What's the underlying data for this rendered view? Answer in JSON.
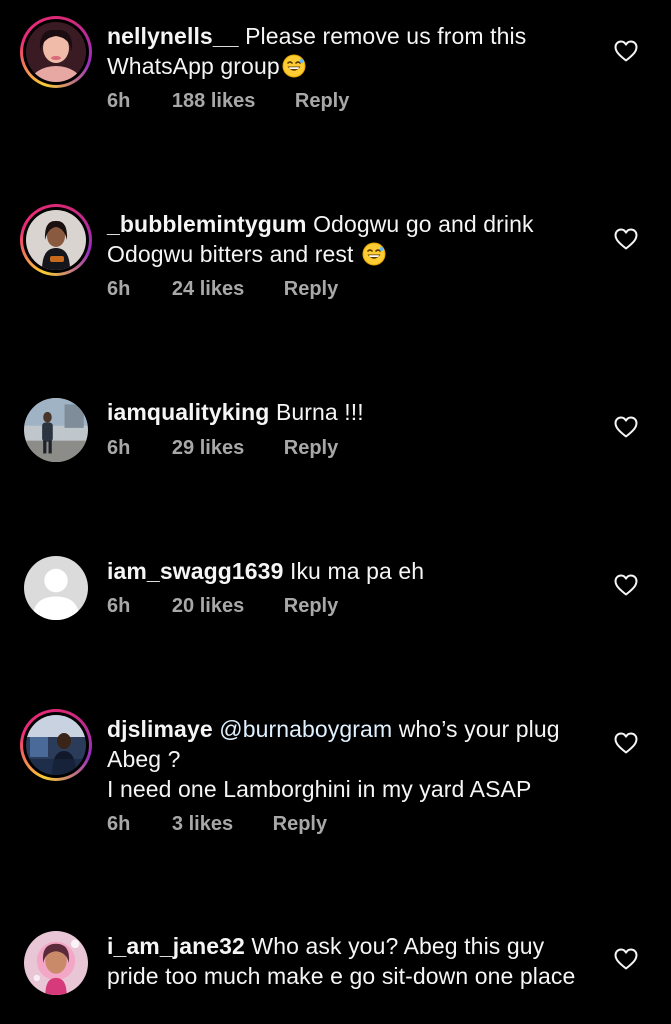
{
  "comments": [
    {
      "username": "nellynells__",
      "text": "Please remove us from this WhatsApp group",
      "emoji": "grinning-sweat-emoji",
      "time": "6h",
      "likes": "188 likes",
      "reply": "Reply"
    },
    {
      "username": "_bubblemintygum",
      "text": "Odogwu go and drink Odogwu bitters and rest",
      "emoji": "grinning-sweat-emoji",
      "time": "6h",
      "likes": "24 likes",
      "reply": "Reply"
    },
    {
      "username": "iamqualityking",
      "text": "Burna !!!",
      "time": "6h",
      "likes": "29 likes",
      "reply": "Reply"
    },
    {
      "username": "iam_swagg1639",
      "text": "Iku ma pa eh",
      "time": "6h",
      "likes": "20 likes",
      "reply": "Reply"
    },
    {
      "username": "djslimaye",
      "mention": "@burnaboygram",
      "text_line1": "who’s your plug",
      "text_line2": "Abeg ?",
      "text_line3": "I need one Lamborghini in my yard ASAP",
      "time": "6h",
      "likes": "3 likes",
      "reply": "Reply"
    },
    {
      "username": "i_am_jane32",
      "text": "Who ask you? Abeg this guy pride too much make e go sit-down one place"
    }
  ],
  "icons": {
    "like": "heart-outline-icon"
  },
  "colors": {
    "background": "#000000",
    "text": "#f5f5f5",
    "meta": "#a8a8a8",
    "story_ring_start": "#f9ce34",
    "story_ring_end": "#962fbf"
  }
}
